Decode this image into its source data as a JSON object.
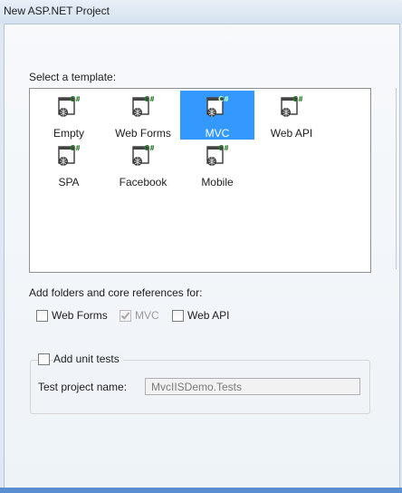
{
  "window": {
    "title": "New ASP.NET Project"
  },
  "templates": {
    "label": "Select a template:",
    "items": [
      {
        "name": "Empty",
        "selected": false
      },
      {
        "name": "Web Forms",
        "selected": false
      },
      {
        "name": "MVC",
        "selected": true
      },
      {
        "name": "Web API",
        "selected": false
      },
      {
        "name": "SPA",
        "selected": false
      },
      {
        "name": "Facebook",
        "selected": false
      },
      {
        "name": "Mobile",
        "selected": false
      }
    ],
    "icon_badge": "C#"
  },
  "references": {
    "label": "Add folders and core references for:",
    "options": [
      {
        "label": "Web Forms",
        "checked": false,
        "enabled": true
      },
      {
        "label": "MVC",
        "checked": true,
        "enabled": false
      },
      {
        "label": "Web API",
        "checked": false,
        "enabled": true
      }
    ]
  },
  "unit_tests": {
    "label": "Add unit tests",
    "checked": false,
    "project_name_label": "Test project name:",
    "project_name_value": "MvcIISDemo.Tests"
  },
  "colors": {
    "selection": "#3399ff",
    "accent": "#5a8ed0"
  }
}
